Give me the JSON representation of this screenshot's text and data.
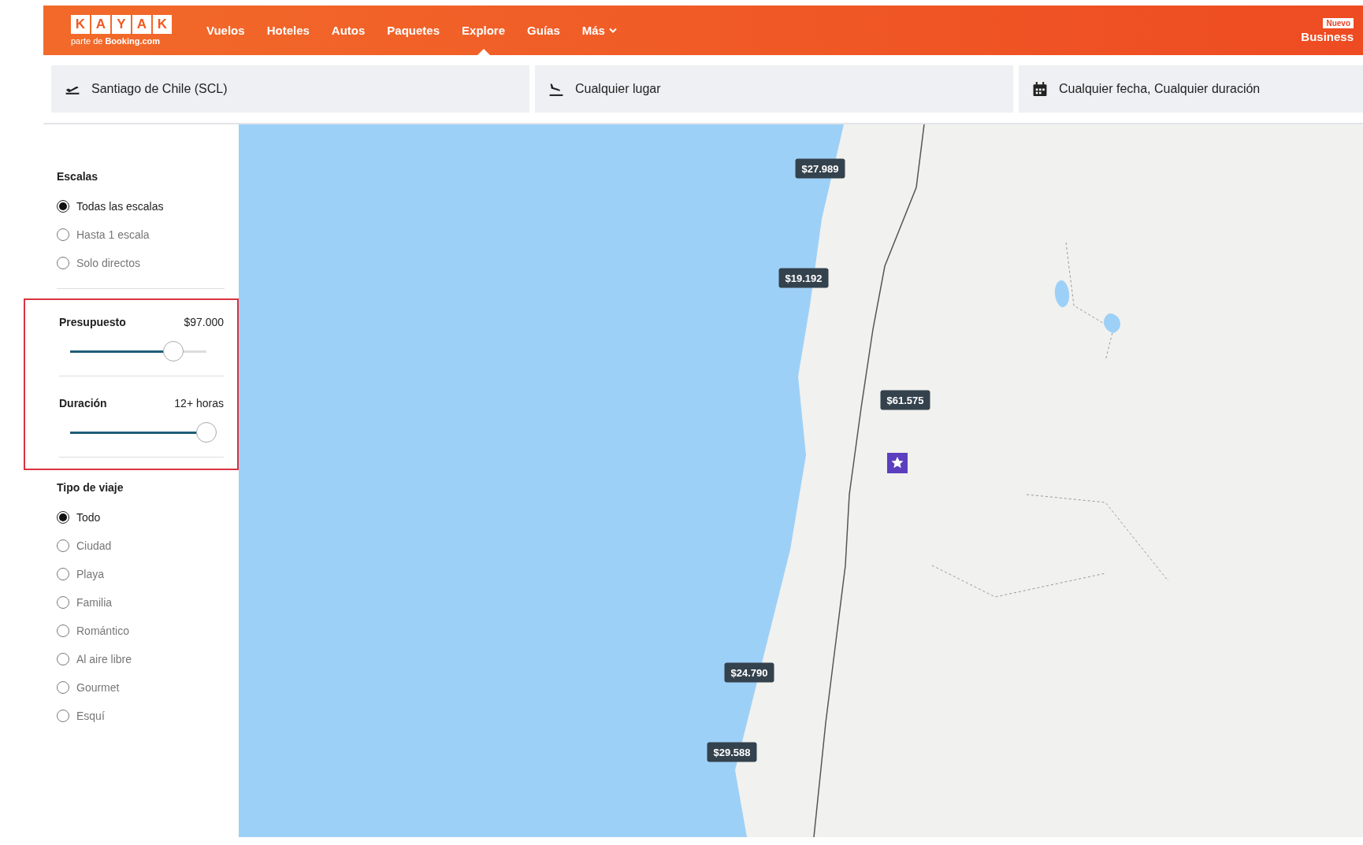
{
  "header": {
    "logo": [
      "K",
      "A",
      "Y",
      "A",
      "K"
    ],
    "tagline": "parte de **Booking.com**",
    "nav": [
      {
        "label": "Vuelos",
        "selected": false,
        "dropdown": false
      },
      {
        "label": "Hoteles",
        "selected": false,
        "dropdown": false
      },
      {
        "label": "Autos",
        "selected": false,
        "dropdown": false
      },
      {
        "label": "Paquetes",
        "selected": false,
        "dropdown": false
      },
      {
        "label": "Explore",
        "selected": true,
        "dropdown": false
      },
      {
        "label": "Guías",
        "selected": false,
        "dropdown": false
      },
      {
        "label": "Más",
        "selected": false,
        "dropdown": true
      }
    ],
    "business": {
      "badge": "Nuevo",
      "label": "Business"
    }
  },
  "search": [
    {
      "kind": "origin",
      "value": "Santiago de Chile (SCL)"
    },
    {
      "kind": "destination",
      "value": "Cualquier lugar"
    },
    {
      "kind": "dates",
      "value": "Cualquier fecha, Cualquier duración"
    }
  ],
  "filters": {
    "stops": {
      "title": "Escalas",
      "options": [
        {
          "label": "Todas las escalas",
          "selected": true
        },
        {
          "label": "Hasta 1 escala",
          "selected": false
        },
        {
          "label": "Solo directos",
          "selected": false
        }
      ]
    },
    "sliders": [
      {
        "title": "Presupuesto",
        "reading": "$97.000",
        "level": 0.76
      },
      {
        "title": "Duración",
        "reading": "12+ horas",
        "level": 1.0
      }
    ],
    "trip_type": {
      "title": "Tipo de viaje",
      "options": [
        {
          "label": "Todo",
          "selected": true
        },
        {
          "label": "Ciudad",
          "selected": false
        },
        {
          "label": "Playa",
          "selected": false
        },
        {
          "label": "Familia",
          "selected": false
        },
        {
          "label": "Romántico",
          "selected": false
        },
        {
          "label": "Al aire libre",
          "selected": false
        },
        {
          "label": "Gourmet",
          "selected": false
        },
        {
          "label": "Esquí",
          "selected": false
        }
      ]
    }
  },
  "map": {
    "prices": [
      "$27.989",
      "$19.192",
      "$61.575",
      "$24.790",
      "$29.588"
    ]
  }
}
